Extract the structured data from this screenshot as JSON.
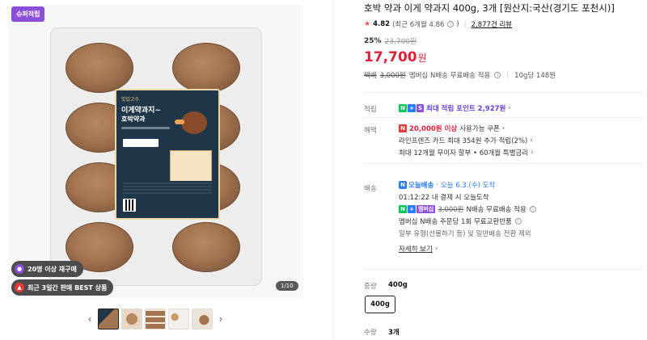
{
  "gallery": {
    "super_badge": "슈퍼적립",
    "pill_repurchase": "20명 이상 재구매",
    "pill_best": "최근 3일간 판매 BEST 상품",
    "counter": "1/10",
    "label_brand": "맛있고수",
    "label_title": "이게약과지~",
    "label_sub": "호박약과",
    "thumb_prev_icon": "chevron-left-icon",
    "thumb_next_icon": "chevron-right-icon",
    "thumb_count": 5
  },
  "product": {
    "title": "호박 약과 이게 약과지 400g, 3개 [원산지:국산(경기도 포천시)]",
    "rating": "4.82",
    "rating_recent": "(최근 6개월 4.86",
    "rating_recent_close": ")",
    "reviews": "2,877건 리뷰",
    "discount_rate": "25%",
    "original_price": "23,700원",
    "price": "17,700",
    "price_unit": "원",
    "ship_prefix": "택배",
    "ship_strike": "3,000원",
    "ship_text": "멤버십 N배송 무료배송 적용",
    "unit_price": "10g당 148원"
  },
  "sections": {
    "reward_label": "적립",
    "reward_point": "최대 적립 포인트 2,927원",
    "benefit_label": "혜택",
    "benefit_coupon_amount": "20,000원 이상",
    "benefit_coupon_text": "사용가능 쿠폰",
    "benefit_card": "라인프렌즈 카드 최대 354원 추가 적립(2%)",
    "benefit_installment": "최대 12개월 무이자 할부 • 60개월 특별금리",
    "delivery_label": "배송",
    "delivery_badge": "오늘배송",
    "delivery_date": "오늘 6.3.(수) 도착",
    "delivery_cutoff": "01:12:22  내 결제 시 오늘도착",
    "delivery_member_tag": "멤버십",
    "delivery_fee_strike": "3,000원",
    "delivery_fee_text": "N배송 무료배송 적용",
    "delivery_return": "멤버십 N배송 주문당 1회 무료교환반품",
    "delivery_exclude": "일부 유형(선물하기 등) 및 일반배송 전환 제외",
    "delivery_more": "자세히 보기",
    "weight_label": "중량",
    "weight_value": "400g",
    "weight_option": "400g",
    "qty_label": "수량",
    "qty_value": "3개"
  },
  "colors": {
    "price_red": "#e0203a",
    "super_purple": "#8b4fd8",
    "naver_green": "#03c75a",
    "plus_blue": "#2d7cf6"
  }
}
